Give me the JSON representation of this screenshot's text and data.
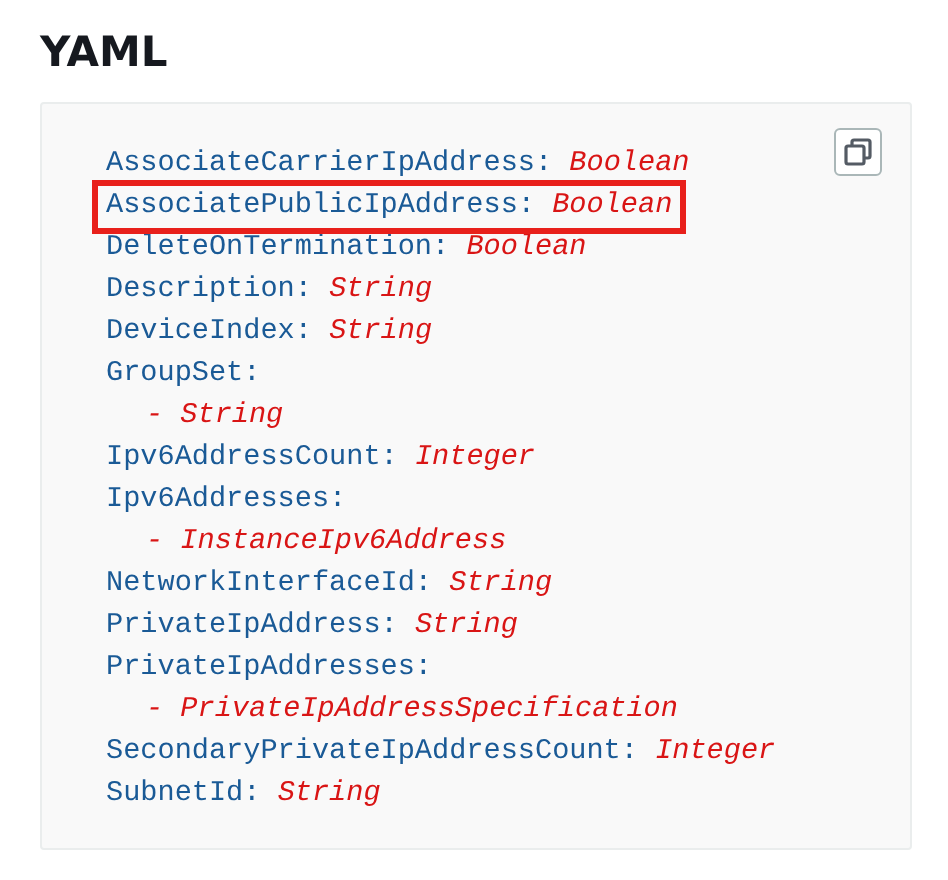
{
  "heading": "YAML",
  "lines": [
    {
      "kind": "pair",
      "key": "AssociateCarrierIpAddress:",
      "value": "Boolean",
      "highlighted": false
    },
    {
      "kind": "pair",
      "key": "AssociatePublicIpAddress:",
      "value": "Boolean",
      "highlighted": true
    },
    {
      "kind": "pair",
      "key": "DeleteOnTermination:",
      "value": "Boolean",
      "highlighted": false
    },
    {
      "kind": "pair",
      "key": "Description:",
      "value": "String",
      "highlighted": false
    },
    {
      "kind": "pair",
      "key": "DeviceIndex:",
      "value": "String",
      "highlighted": false
    },
    {
      "kind": "pair",
      "key": "GroupSet:",
      "highlighted": false
    },
    {
      "kind": "item",
      "value": "- String",
      "highlighted": false
    },
    {
      "kind": "pair",
      "key": "Ipv6AddressCount:",
      "value": "Integer",
      "highlighted": false
    },
    {
      "kind": "pair",
      "key": "Ipv6Addresses:",
      "highlighted": false
    },
    {
      "kind": "item",
      "value": "- InstanceIpv6Address",
      "highlighted": false
    },
    {
      "kind": "pair",
      "key": "NetworkInterfaceId:",
      "value": "String",
      "highlighted": false
    },
    {
      "kind": "pair",
      "key": "PrivateIpAddress:",
      "value": "String",
      "highlighted": false
    },
    {
      "kind": "pair",
      "key": "PrivateIpAddresses:",
      "highlighted": false
    },
    {
      "kind": "item",
      "value": "- PrivateIpAddressSpecification",
      "highlighted": false
    },
    {
      "kind": "pair",
      "key": "SecondaryPrivateIpAddressCount:",
      "value": "Integer",
      "highlighted": false
    },
    {
      "kind": "pair",
      "key": "SubnetId:",
      "value": "String",
      "highlighted": false
    }
  ]
}
